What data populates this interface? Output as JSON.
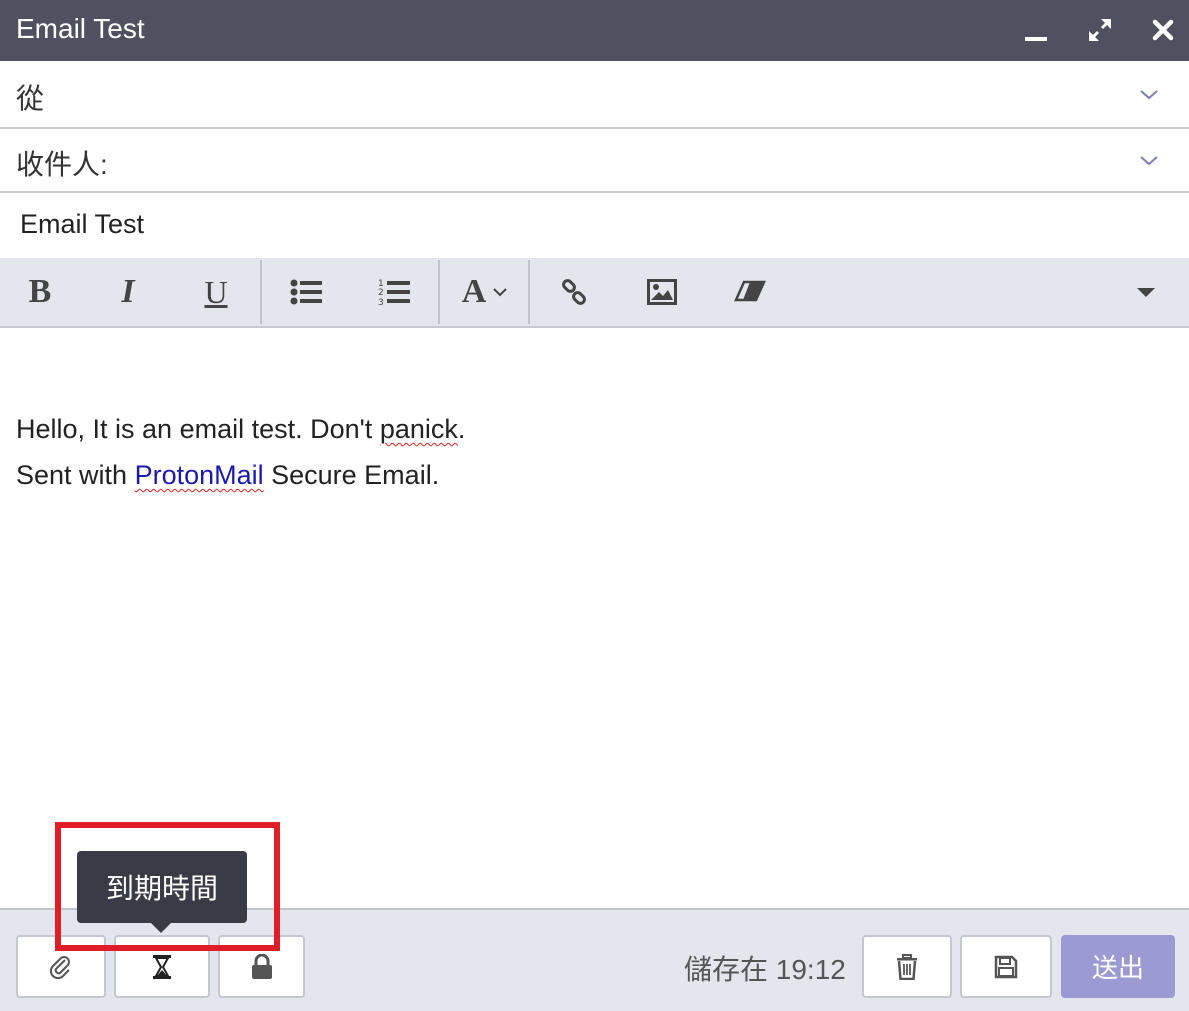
{
  "window": {
    "title": "Email Test"
  },
  "fields": {
    "from_label": "從",
    "to_label": "收件人:",
    "subject_value": "Email Test"
  },
  "toolbar": {
    "bold": "B",
    "italic": "I",
    "underline": "U",
    "font": "A",
    "icons": [
      "bold-icon",
      "italic-icon",
      "underline-icon",
      "bullet-list-icon",
      "numbered-list-icon",
      "font-icon",
      "link-icon",
      "image-icon",
      "eraser-icon",
      "more-icon"
    ]
  },
  "body": {
    "line1_before": "Hello, It is an email test. Don't ",
    "line1_misspelled": "panick",
    "line1_after": ".",
    "line2_before": "Sent with ",
    "line2_link": "ProtonMail",
    "line2_after": " Secure Email."
  },
  "footer": {
    "saved_text": "儲存在 19:12",
    "send_label": "送出"
  },
  "tooltip": {
    "text": "到期時間"
  },
  "colors": {
    "titlebar": "#505061",
    "toolbar_bg": "#e4e6ee",
    "send_button": "#9b9ad2",
    "highlight": "#e01e2a",
    "link": "#1a1ab0"
  }
}
